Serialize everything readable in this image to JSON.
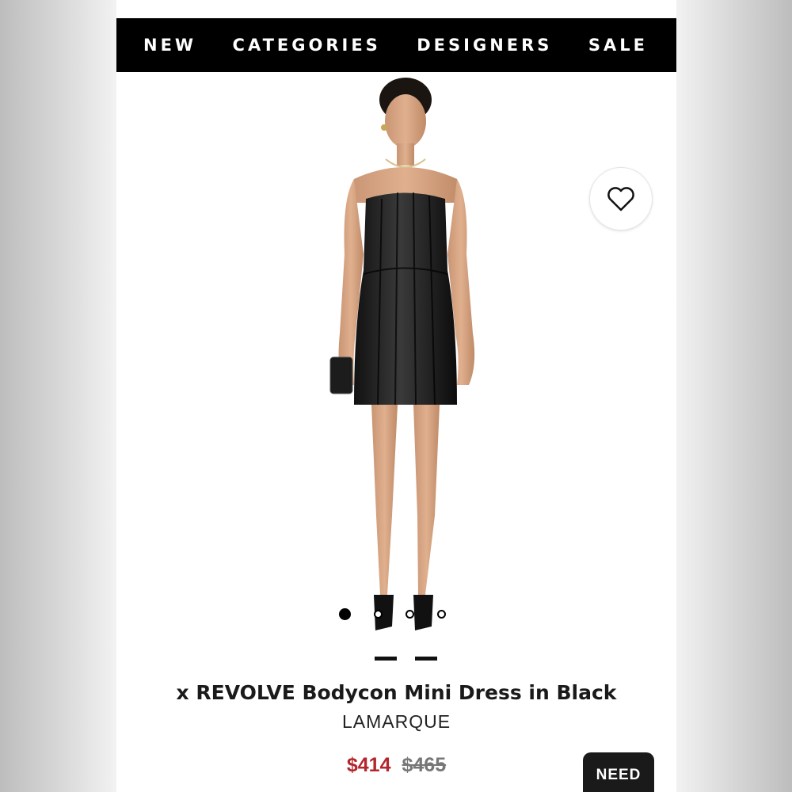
{
  "nav": {
    "items": [
      {
        "label": "NEW"
      },
      {
        "label": "CATEGORIES"
      },
      {
        "label": "DESIGNERS"
      },
      {
        "label": "SALE"
      }
    ]
  },
  "product": {
    "title": "x REVOLVE Bodycon Mini Dress in Black",
    "brand": "LAMARQUE",
    "price_sale": "$414",
    "price_original": "$465",
    "image_count": 4,
    "active_image_index": 0
  },
  "actions": {
    "wishlist_icon": "heart-icon",
    "need_button_label": "NEED"
  },
  "colors": {
    "nav_background": "#000000",
    "sale_price": "#b3262c",
    "original_price": "#777777"
  }
}
